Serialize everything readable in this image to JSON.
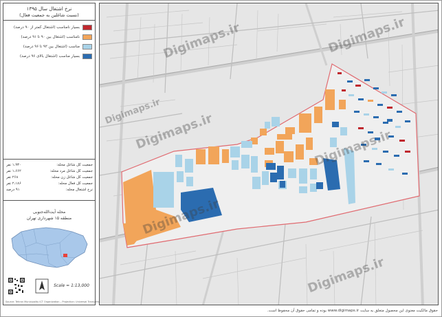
{
  "legend": {
    "title": "نرخ اشتغال سال ۱۳۹۵",
    "subtitle": "(نسبت شاغلین به جمعیت فعال)",
    "items": [
      {
        "label": "بسیار نامناسب (اشتغال کمتر از ۹۰ درصد)",
        "color": "#c0282e"
      },
      {
        "label": "نامناسب (اشتغال بین ۹۰ تا ۹۱ درصد)",
        "color": "#f2a55a"
      },
      {
        "label": "مناسب (اشتغال بین ۹۲ تا ۹۶ درصد)",
        "color": "#a9d3e8"
      },
      {
        "label": "بسیار مناسب (اشتغال بالای ۹۶ درصد)",
        "color": "#2b6cb0"
      }
    ]
  },
  "stats": [
    {
      "key": "جمعیت کل شاغل محله:",
      "value": "۱،۹۳۰ نفر"
    },
    {
      "key": "جمعیت کل شاغل مرد محله:",
      "value": "۱،۶۶۲ نفر"
    },
    {
      "key": "جمعیت کل شاغل زن محله:",
      "value": "۲۶۸ نفر"
    },
    {
      "key": "جمعیت کل فعال محله:",
      "value": "۲،۱۸۶ نفر"
    },
    {
      "key": "نرخ اشتغال محله:",
      "value": "۹۱ درصد"
    }
  ],
  "location": {
    "line1": "محله آیت‌الله‌جنوبی",
    "line2": "منطقه ۱۵ شهرداری تهران"
  },
  "scale": "Scale = 1:13,000",
  "north_label": "N",
  "credit": "Source: Tehran Municipality ICT Organization – Projection: Universal Transverse Mercator",
  "copyright": "حقوق مالکیت معنوی این محصول متعلق به سایت www.digimaps.ir بوده و تمامی حقوق آن محفوظ است.",
  "watermark": "Digimaps.ir",
  "icons": {
    "north": "north-arrow-icon",
    "qr": "qr-code-icon"
  }
}
